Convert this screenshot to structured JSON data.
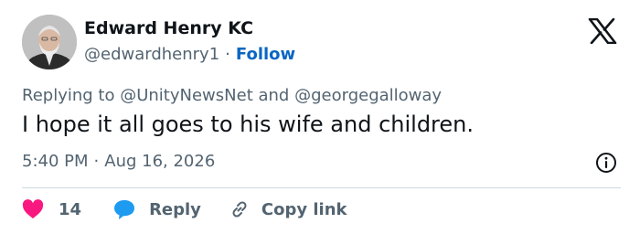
{
  "author": {
    "name": "Edward Henry KC",
    "handle": "@edwardhenry1",
    "separator": "·",
    "follow_label": "Follow"
  },
  "brand": {
    "icon": "x-logo-icon"
  },
  "reply_context": {
    "prefix": "Replying to",
    "mention_1": "@UnityNewsNet",
    "conjunction": "and",
    "mention_2": "@georgegalloway"
  },
  "tweet": {
    "text": "I hope it all goes to his wife and children.",
    "time": "5:40 PM",
    "separator": "·",
    "date": "Aug 16, 2026"
  },
  "actions": {
    "like_count": "14",
    "reply_label": "Reply",
    "copy_link_label": "Copy link"
  },
  "colors": {
    "text": "#0f1419",
    "secondary_text": "#536471",
    "follow_link": "#0a66c2",
    "like_heart": "#f91880",
    "reply_bubble": "#1d9bf0",
    "divider": "#cfd9de"
  }
}
